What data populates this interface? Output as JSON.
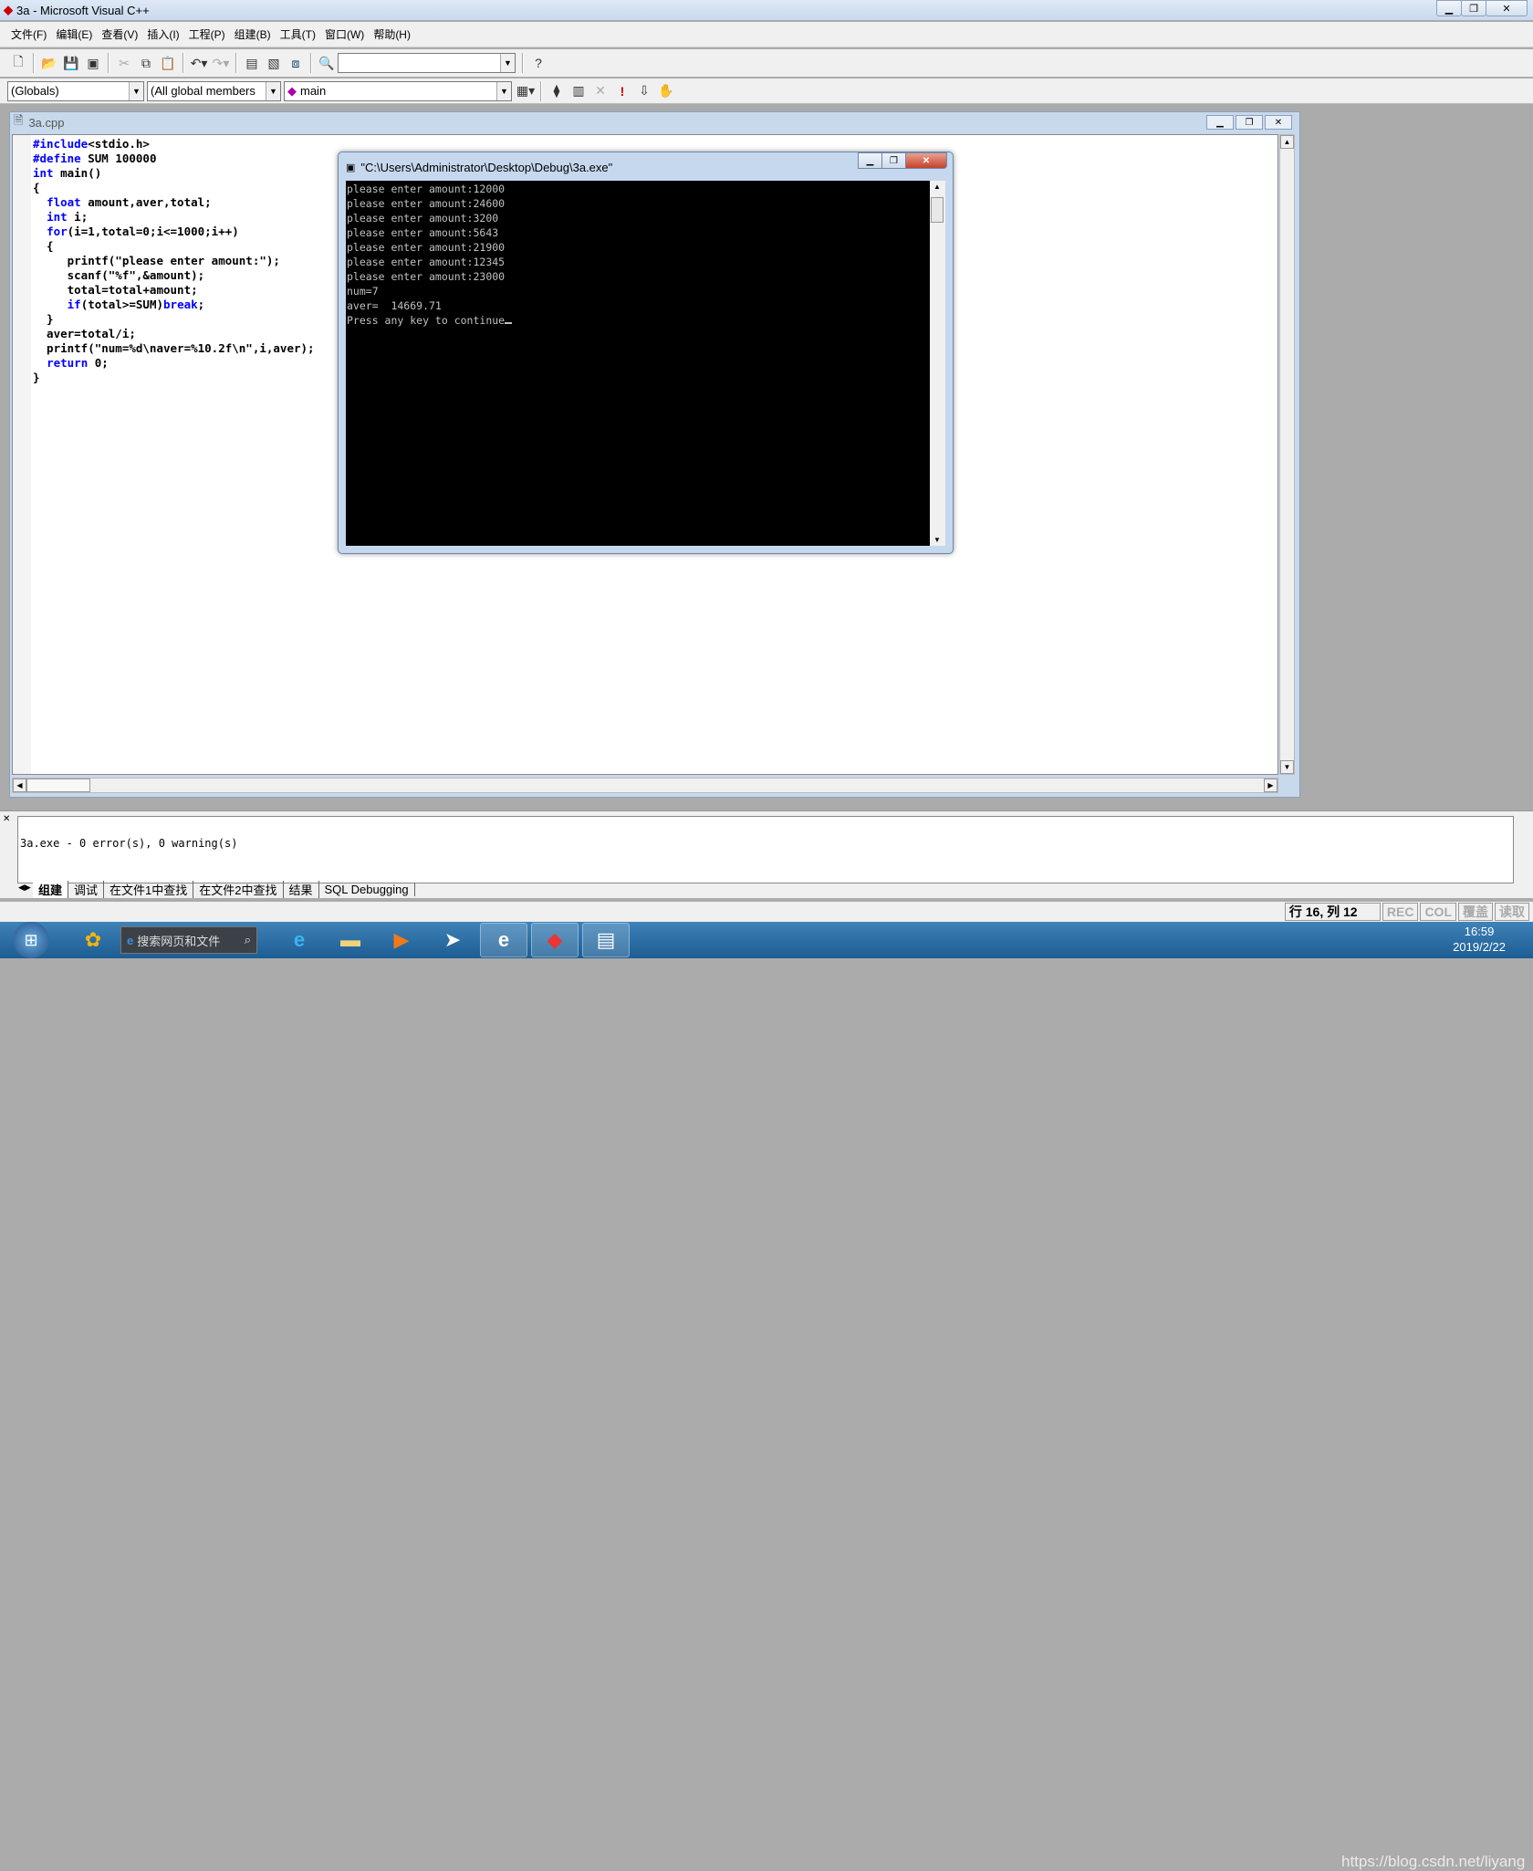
{
  "window": {
    "title": "3a - Microsoft Visual C++",
    "buttons": [
      "minimize",
      "restore",
      "close"
    ]
  },
  "menu": [
    "文件(F)",
    "编辑(E)",
    "查看(V)",
    "插入(I)",
    "工程(P)",
    "组建(B)",
    "工具(T)",
    "窗口(W)",
    "帮助(H)"
  ],
  "toolbar1": {
    "icons": [
      "new-file-icon",
      "open-icon",
      "save-icon",
      "save-all-icon",
      "cut-icon",
      "copy-icon",
      "paste-icon",
      "undo-icon",
      "redo-icon",
      "workspace-icon",
      "output-icon",
      "windows-icon",
      "find-in-files-icon",
      "search-icon"
    ],
    "find_value": ""
  },
  "toolbar2": {
    "scope": "(Globals)",
    "members": "(All global members",
    "function": "main",
    "icons": [
      "wizard-action-icon",
      "compile-icon",
      "build-icon",
      "stop-build-icon",
      "execute-icon",
      "go-icon",
      "breakpoint-icon"
    ]
  },
  "editor": {
    "filename": "3a.cpp",
    "lines": [
      {
        "tokens": [
          {
            "t": "#include",
            "k": 1
          },
          {
            "t": "<stdio.h>",
            "k": 0
          }
        ]
      },
      {
        "tokens": [
          {
            "t": "#define",
            "k": 1
          },
          {
            "t": " SUM 100000",
            "k": 0
          }
        ]
      },
      {
        "tokens": [
          {
            "t": "int",
            "k": 1
          },
          {
            "t": " main()",
            "k": 0
          }
        ]
      },
      {
        "tokens": [
          {
            "t": "{",
            "k": 0
          }
        ]
      },
      {
        "tokens": [
          {
            "t": "  ",
            "k": 0
          },
          {
            "t": "float",
            "k": 1
          },
          {
            "t": " amount,aver,total;",
            "k": 0
          }
        ]
      },
      {
        "tokens": [
          {
            "t": "  ",
            "k": 0
          },
          {
            "t": "int",
            "k": 1
          },
          {
            "t": " i;",
            "k": 0
          }
        ]
      },
      {
        "tokens": [
          {
            "t": "  ",
            "k": 0
          },
          {
            "t": "for",
            "k": 1
          },
          {
            "t": "(i=1,total=0;i<=1000;i++)",
            "k": 0
          }
        ]
      },
      {
        "tokens": [
          {
            "t": "  {",
            "k": 0
          }
        ]
      },
      {
        "tokens": [
          {
            "t": "     printf(\"please enter amount:\");",
            "k": 0
          }
        ]
      },
      {
        "tokens": [
          {
            "t": "     scanf(\"%f\",&amount);",
            "k": 0
          }
        ]
      },
      {
        "tokens": [
          {
            "t": "     total=total+amount;",
            "k": 0
          }
        ]
      },
      {
        "tokens": [
          {
            "t": "     ",
            "k": 0
          },
          {
            "t": "if",
            "k": 1
          },
          {
            "t": "(total>=SUM)",
            "k": 0
          },
          {
            "t": "break",
            "k": 1
          },
          {
            "t": ";",
            "k": 0
          }
        ]
      },
      {
        "tokens": [
          {
            "t": "  }",
            "k": 0
          }
        ]
      },
      {
        "tokens": [
          {
            "t": "  aver=total/i;",
            "k": 0
          }
        ]
      },
      {
        "tokens": [
          {
            "t": "  printf(\"num=%d\\naver=%10.2f\\n\",i,aver);",
            "k": 0
          }
        ]
      },
      {
        "tokens": [
          {
            "t": "  ",
            "k": 0
          },
          {
            "t": "return",
            "k": 1
          },
          {
            "t": " 0;",
            "k": 0
          }
        ]
      },
      {
        "tokens": [
          {
            "t": "}",
            "k": 0
          }
        ]
      }
    ]
  },
  "console": {
    "title": "\"C:\\Users\\Administrator\\Desktop\\Debug\\3a.exe\"",
    "lines": [
      "please enter amount:12000",
      "please enter amount:24600",
      "please enter amount:3200",
      "please enter amount:5643",
      "please enter amount:21900",
      "please enter amount:12345",
      "please enter amount:23000",
      "num=7",
      "aver=  14669.71",
      "Press any key to continue"
    ]
  },
  "output": {
    "text": "3a.exe - 0 error(s), 0 warning(s)",
    "tabs": [
      "组建",
      "调试",
      "在文件1中查找",
      "在文件2中查找",
      "结果",
      "SQL Debugging"
    ],
    "active_tab": "组建"
  },
  "status": {
    "position": "行 16, 列 12",
    "rec": "REC",
    "col": "COL",
    "ovr": "覆盖",
    "read": "读取"
  },
  "taskbar": {
    "search_placeholder": "搜索网页和文件",
    "time": "16:59",
    "date": "2019/2/22",
    "watermark": "https://blog.csdn.net/liyang"
  }
}
